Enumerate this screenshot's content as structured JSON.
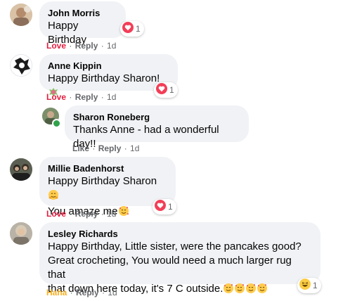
{
  "comments": [
    {
      "author": "John Morris",
      "lines": [
        "Happy Birthday"
      ],
      "reaction": {
        "icon": "love-reaction-icon",
        "count": "1"
      },
      "actions": {
        "reaction_label": "Love",
        "reply": "Reply",
        "time": "1d"
      }
    },
    {
      "author": "Anne Kippin",
      "lines": [
        "Happy Birthday Sharon! "
      ],
      "inline_emoji": "gift-emoji",
      "reaction": {
        "icon": "love-reaction-icon",
        "count": "1"
      },
      "actions": {
        "reaction_label": "Love",
        "reply": "Reply",
        "time": "1d"
      }
    },
    {
      "author": "Sharon Roneberg",
      "lines": [
        "Thanks Anne - had a wonderful day!!"
      ],
      "online": true,
      "actions": {
        "like": "Like",
        "reply": "Reply",
        "time": "1d"
      }
    },
    {
      "author": "Millie Badenhorst",
      "lines": [
        "Happy Birthday Sharon ",
        "You amaze me"
      ],
      "inline_emoji": "hugging-face-emoji, smiling-face-with-hearts-emoji",
      "reaction": {
        "icon": "love-reaction-icon",
        "count": "1"
      },
      "actions": {
        "reaction_label": "Love",
        "reply": "Reply",
        "time": "1d"
      }
    },
    {
      "author": "Lesley Richards",
      "lines": [
        "Happy Birthday, Little sister, were the pancakes good?",
        "Great crocheting, You would need a much larger rug that",
        "that down here today, it's 7 C outside."
      ],
      "inline_emoji": "smiling-face-with-hearts-emoji x4",
      "reaction": {
        "icon": "haha-reaction-icon",
        "count": "1"
      },
      "actions": {
        "reaction_label": "Haha",
        "reply": "Reply",
        "time": "1d"
      }
    }
  ],
  "colors": {
    "bubble": "#f0f2f5",
    "love": "#e41e3f",
    "haha": "#f7b125",
    "meta": "#65676b",
    "online": "#31a24c"
  }
}
